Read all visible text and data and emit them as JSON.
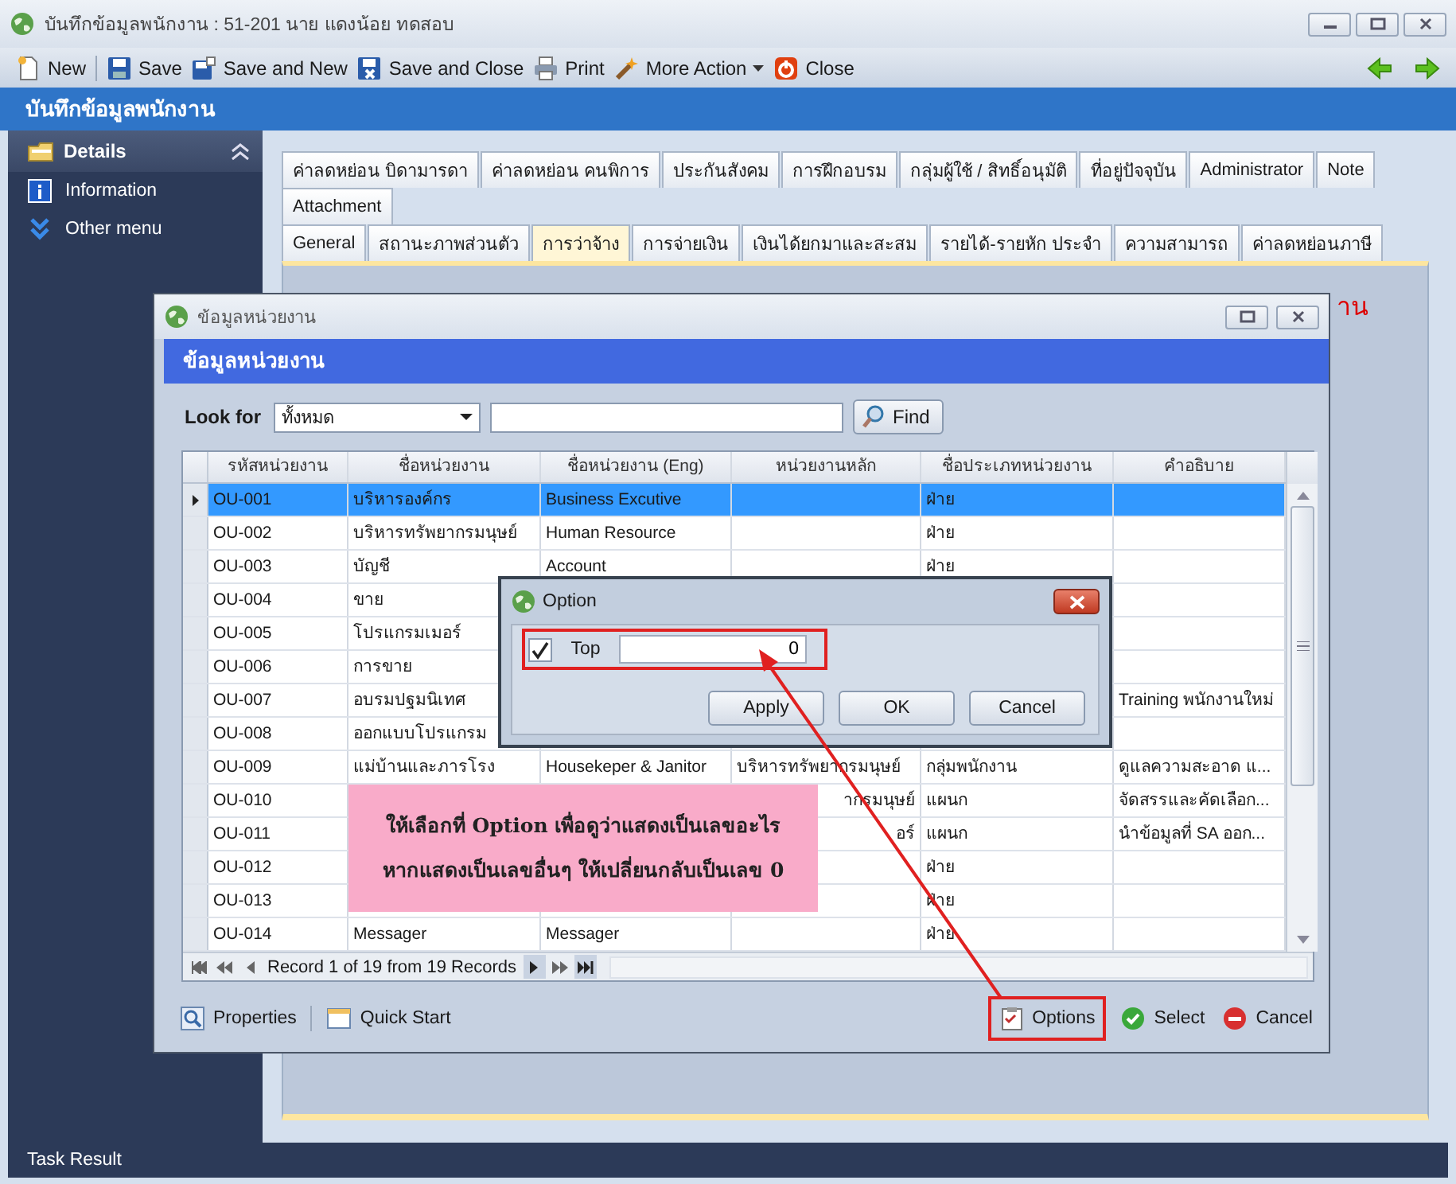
{
  "window": {
    "title": "บันทึกข้อมูลพนักงาน : 51-201 นาย แดงน้อย ทดสอบ"
  },
  "toolbar": [
    {
      "label": "New",
      "kind": "new"
    },
    {
      "label": "Save",
      "kind": "save"
    },
    {
      "label": "Save and New",
      "kind": "save-new"
    },
    {
      "label": "Save and Close",
      "kind": "save-close"
    },
    {
      "label": "Print",
      "kind": "print"
    },
    {
      "label": "More Action",
      "kind": "menu"
    },
    {
      "label": "Close",
      "kind": "close"
    }
  ],
  "form_header": "บันทึกข้อมูลพนักงาน",
  "sidebar": {
    "title": "Details",
    "expanded": true,
    "items": [
      {
        "label": "Information",
        "kind": "info"
      },
      {
        "label": "Other menu",
        "kind": "more"
      }
    ]
  },
  "tab_rows": [
    [
      {
        "label": "ค่าลดหย่อน บิดามารดา",
        "selected": false
      },
      {
        "label": "ค่าลดหย่อน คนพิการ",
        "selected": false
      },
      {
        "label": "ประกันสังคม",
        "selected": false
      },
      {
        "label": "การฝึกอบรม",
        "selected": false
      },
      {
        "label": "กลุ่มผู้ใช้ / สิทธิ์อนุมัติ",
        "selected": false
      },
      {
        "label": "ที่อยู่ปัจจุบัน",
        "selected": false
      },
      {
        "label": "Administrator",
        "selected": false
      },
      {
        "label": "Note",
        "selected": false
      }
    ],
    [
      {
        "label": "Attachment",
        "selected": false
      }
    ],
    [
      {
        "label": "General",
        "selected": false
      },
      {
        "label": "สถานะภาพส่วนตัว",
        "selected": false
      },
      {
        "label": "การว่าจ้าง",
        "selected": true
      },
      {
        "label": "การจ่ายเงิน",
        "selected": false
      },
      {
        "label": "เงินได้ยกมาและสะสม",
        "selected": false
      },
      {
        "label": "รายได้-รายหัก ประจำ",
        "selected": false
      },
      {
        "label": "ความสามารถ",
        "selected": false
      },
      {
        "label": "ค่าลดหย่อนภาษี",
        "selected": false
      }
    ]
  ],
  "notice": "าน",
  "dialog": {
    "title": "ข้อมูลหน่วยงาน",
    "header": "ข้อมูลหน่วยงาน",
    "look_for": {
      "label": "Look for",
      "value": "ทั้งหมด"
    },
    "find_button": "Find",
    "columns": [
      "รหัสหน่วยงาน",
      "ชื่อหน่วยงาน",
      "ชื่อหน่วยงาน (Eng)",
      "หน่วยงานหลัก",
      "ชื่อประเภทหน่วยงาน",
      "คำอธิบาย"
    ],
    "rows": [
      {
        "selected": true,
        "cells": [
          "OU-001",
          "บริหารองค์กร",
          "Business Excutive",
          null,
          "ฝ่าย",
          null
        ]
      },
      {
        "selected": false,
        "cells": [
          "OU-002",
          "บริหารทรัพยากรมนุษย์",
          "Human Resource",
          null,
          "ฝ่าย",
          null
        ]
      },
      {
        "selected": false,
        "cells": [
          "OU-003",
          "บัญชี",
          "Account",
          null,
          "ฝ่าย",
          null
        ]
      },
      {
        "selected": false,
        "cells": [
          "OU-004",
          "ขาย",
          null,
          null,
          null,
          null
        ]
      },
      {
        "selected": false,
        "cells": [
          "OU-005",
          "โปรแกรมเมอร์",
          null,
          null,
          null,
          null
        ]
      },
      {
        "selected": false,
        "cells": [
          "OU-006",
          "การขาย",
          null,
          null,
          null,
          null
        ]
      },
      {
        "selected": false,
        "cells": [
          "OU-007",
          "อบรมปฐมนิเทศ",
          null,
          null,
          null,
          "Training พนักงานใหม่"
        ]
      },
      {
        "selected": false,
        "cells": [
          "OU-008",
          "ออกแบบโปรแกรม",
          null,
          null,
          null,
          null
        ]
      },
      {
        "selected": false,
        "cells": [
          "OU-009",
          "แม่บ้านและภารโรง",
          "Housekeper & Janitor",
          "บริหารทรัพยากรมนุษย์",
          "กลุ่มพนักงาน",
          "ดูแลความสะอาด แ..."
        ]
      },
      {
        "selected": false,
        "cells": [
          "OU-010",
          null,
          null,
          {
            "text": "ากรมนุษย์",
            "cut": true
          },
          "แผนก",
          "จัดสรรและคัดเลือก..."
        ]
      },
      {
        "selected": false,
        "cells": [
          "OU-011",
          null,
          null,
          {
            "text": "อร์",
            "cut": true
          },
          "แผนก",
          "นำข้อมูลที่ SA ออก..."
        ]
      },
      {
        "selected": false,
        "cells": [
          "OU-012",
          null,
          null,
          null,
          "ฝ่าย",
          null
        ]
      },
      {
        "selected": false,
        "cells": [
          "OU-013",
          null,
          null,
          null,
          "ฝ่าย",
          null
        ]
      },
      {
        "selected": false,
        "cells": [
          "OU-014",
          "Messager",
          "Messager",
          null,
          "ฝ่าย",
          null
        ]
      }
    ],
    "navigator": "Record 1 of 19 from 19 Records",
    "footer_left": [
      {
        "label": "Properties",
        "kind": "properties"
      },
      {
        "label": "Quick Start",
        "kind": "quickstart"
      }
    ],
    "footer_right": [
      {
        "label": "Options",
        "kind": "options",
        "highlighted": true
      },
      {
        "label": "Select",
        "kind": "select",
        "highlighted": false
      },
      {
        "label": "Cancel",
        "kind": "cancel",
        "highlighted": false
      }
    ]
  },
  "option_dialog": {
    "title": "Option",
    "top": {
      "label": "Top",
      "checked": true,
      "value": "0",
      "highlighted": true
    },
    "buttons": [
      "Apply",
      "OK",
      "Cancel"
    ]
  },
  "callout": {
    "lines": [
      "ให้เลือกที่ Option เพื่อดูว่าแสดงเป็นเลขอะไร",
      "หากแสดงเป็นเลขอื่นๆ ให้เปลี่ยนกลับเป็นเลข 0"
    ]
  },
  "status_bar": "Task Result"
}
